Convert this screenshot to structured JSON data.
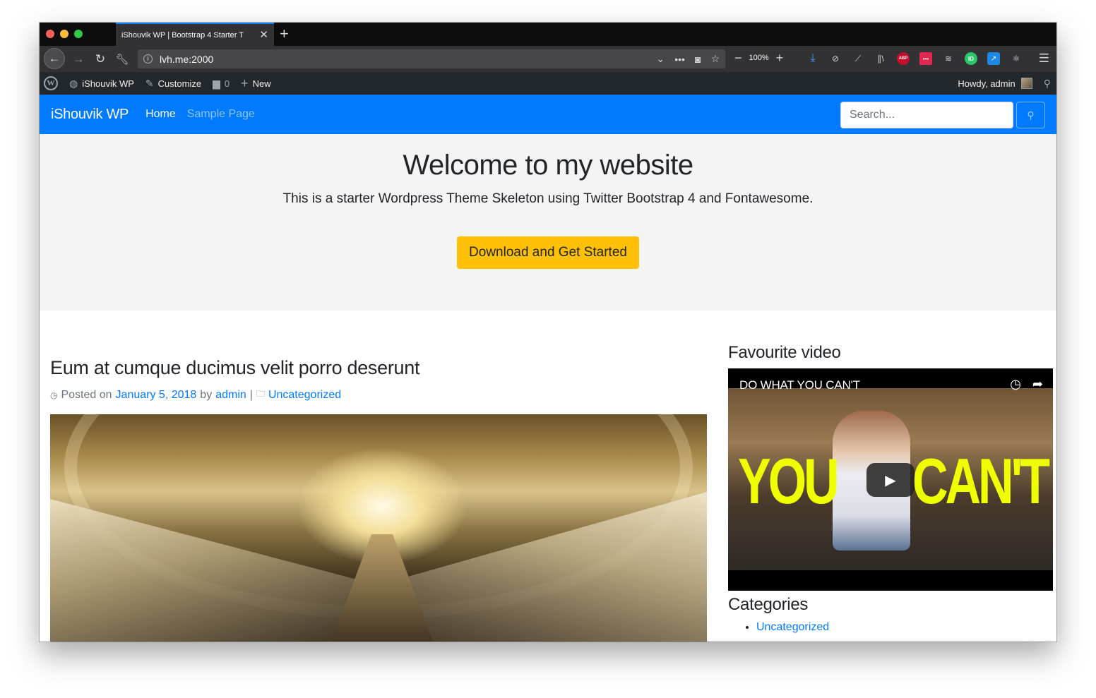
{
  "browser": {
    "tab_title": "iShouvik WP | Bootstrap 4 Starter T",
    "tab_close": "✕",
    "new_tab": "+",
    "url": "lvh.me:2000",
    "zoom": "100%"
  },
  "wp_admin_bar": {
    "site_name": "iShouvik WP",
    "customize": "Customize",
    "comments_count": "0",
    "new_label": "New",
    "howdy": "Howdy, admin"
  },
  "navbar": {
    "brand": "iShouvik WP",
    "links": [
      {
        "label": "Home",
        "active": true
      },
      {
        "label": "Sample Page",
        "active": false
      }
    ],
    "search_placeholder": "Search..."
  },
  "jumbotron": {
    "title": "Welcome to my website",
    "lead": "This is a starter Wordpress Theme Skeleton using Twitter Bootstrap 4 and Fontawesome.",
    "button": "Download and Get Started"
  },
  "post": {
    "title": "Eum at cumque ducimus velit porro deserunt",
    "posted_on": "Posted on",
    "date": "January 5, 2018",
    "by": "by",
    "author": "admin",
    "separator": "|",
    "category": "Uncategorized"
  },
  "sidebar": {
    "video_heading": "Favourite video",
    "video_title": "DO WHAT YOU CAN'T",
    "video_overlay_left": "YOU",
    "video_overlay_right": "CAN'T",
    "categories_heading": "Categories",
    "categories": [
      "Uncategorized"
    ]
  },
  "colors": {
    "primary": "#007bff",
    "warning": "#ffc107",
    "admin_bar": "#23282d",
    "jumbotron_bg": "#f4f4f4"
  }
}
